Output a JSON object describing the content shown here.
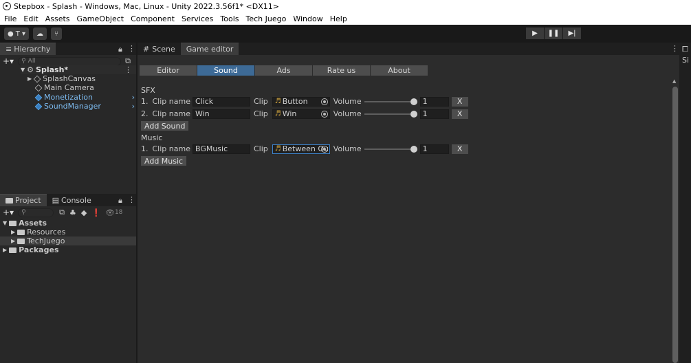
{
  "window": {
    "title": "Stepbox - Splash - Windows, Mac, Linux - Unity 2022.3.56f1* <DX11>"
  },
  "menu": [
    "File",
    "Edit",
    "Assets",
    "GameObject",
    "Component",
    "Services",
    "Tools",
    "Tech Juego",
    "Window",
    "Help"
  ],
  "toolbar": {
    "account_label": "T ▾"
  },
  "hierarchy": {
    "tab": "Hierarchy",
    "search_placeholder": "All",
    "scene": "Splash*",
    "items": [
      "SplashCanvas",
      "Main Camera",
      "Monetization",
      "SoundManager"
    ]
  },
  "project": {
    "tabs": [
      "Project",
      "Console"
    ],
    "eye_count": "18",
    "root": "Assets",
    "children": [
      "Resources",
      "TechJuego"
    ],
    "packages": "Packages"
  },
  "main": {
    "tabs": [
      "Scene",
      "Game editor"
    ],
    "editor_tabs": [
      "Editor",
      "Sound",
      "Ads",
      "Rate us",
      "About"
    ],
    "sfx_label": "SFX",
    "music_label": "Music",
    "clip_name_label": "Clip name",
    "clip_label": "Clip",
    "volume_label": "Volume",
    "sfx": [
      {
        "index": "1.",
        "name": "Click",
        "clip": "Button",
        "volume": "1"
      },
      {
        "index": "2.",
        "name": "Win",
        "clip": "Win",
        "volume": "1"
      }
    ],
    "music": [
      {
        "index": "1.",
        "name": "BGMusic",
        "clip": "Between Ou",
        "volume": "1"
      }
    ],
    "add_sound": "Add Sound",
    "add_music": "Add Music",
    "remove": "X"
  },
  "right_panel": {
    "label": "Si"
  }
}
